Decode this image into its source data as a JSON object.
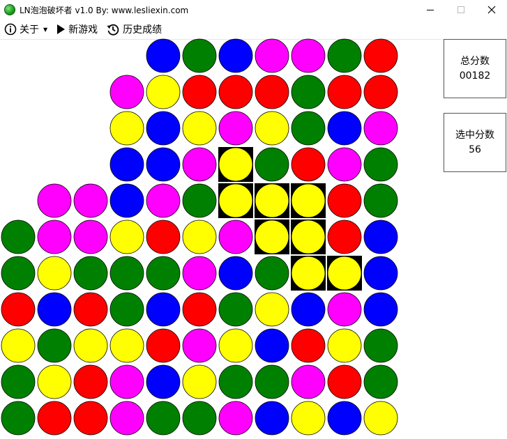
{
  "window": {
    "title": "LN泡泡破坏者 v1.0   By: www.lesliexin.com",
    "controls": [
      "minimize",
      "maximize",
      "close"
    ]
  },
  "toolbar": {
    "about_label": "关于",
    "about_icon": "info-icon",
    "new_game_label": "新游戏",
    "new_game_icon": "play-icon",
    "history_label": "历史成绩",
    "history_icon": "history-icon"
  },
  "scores": {
    "total_label": "总分数",
    "total_value": "00182",
    "selected_label": "选中分数",
    "selected_value": "56"
  },
  "colors": {
    "R": "#ff0000",
    "G": "#008000",
    "B": "#0000ff",
    "M": "#ff00ff",
    "Y": "#ffff00",
    "selection_bg": "#000000",
    "bubble_outline": "#000000"
  },
  "board": {
    "columns": 11,
    "rows": 11,
    "cells": [
      [
        "",
        "",
        "",
        "",
        "B",
        "G",
        "B",
        "M",
        "M",
        "G",
        "R"
      ],
      [
        "",
        "",
        "",
        "M",
        "Y",
        "R",
        "R",
        "R",
        "G",
        "R",
        "R"
      ],
      [
        "",
        "",
        "",
        "Y",
        "B",
        "Y",
        "M",
        "Y",
        "G",
        "B",
        "M"
      ],
      [
        "",
        "",
        "",
        "B",
        "B",
        "M",
        "Y",
        "G",
        "R",
        "M",
        "G"
      ],
      [
        "",
        "M",
        "M",
        "B",
        "M",
        "G",
        "Y",
        "Y",
        "Y",
        "R",
        "G"
      ],
      [
        "G",
        "M",
        "M",
        "Y",
        "R",
        "Y",
        "M",
        "Y",
        "Y",
        "R",
        "B"
      ],
      [
        "G",
        "Y",
        "G",
        "G",
        "G",
        "M",
        "B",
        "G",
        "Y",
        "Y",
        "B"
      ],
      [
        "R",
        "B",
        "R",
        "G",
        "B",
        "R",
        "G",
        "Y",
        "B",
        "M",
        "B"
      ],
      [
        "Y",
        "G",
        "Y",
        "Y",
        "R",
        "M",
        "Y",
        "B",
        "R",
        "Y",
        "G"
      ],
      [
        "G",
        "Y",
        "R",
        "M",
        "B",
        "Y",
        "G",
        "G",
        "M",
        "R",
        "G"
      ],
      [
        "G",
        "R",
        "R",
        "M",
        "G",
        "G",
        "M",
        "B",
        "Y",
        "B",
        "Y"
      ]
    ],
    "selected": [
      [
        3,
        6
      ],
      [
        4,
        6
      ],
      [
        4,
        7
      ],
      [
        4,
        8
      ],
      [
        5,
        7
      ],
      [
        5,
        8
      ],
      [
        6,
        8
      ],
      [
        6,
        9
      ]
    ]
  }
}
